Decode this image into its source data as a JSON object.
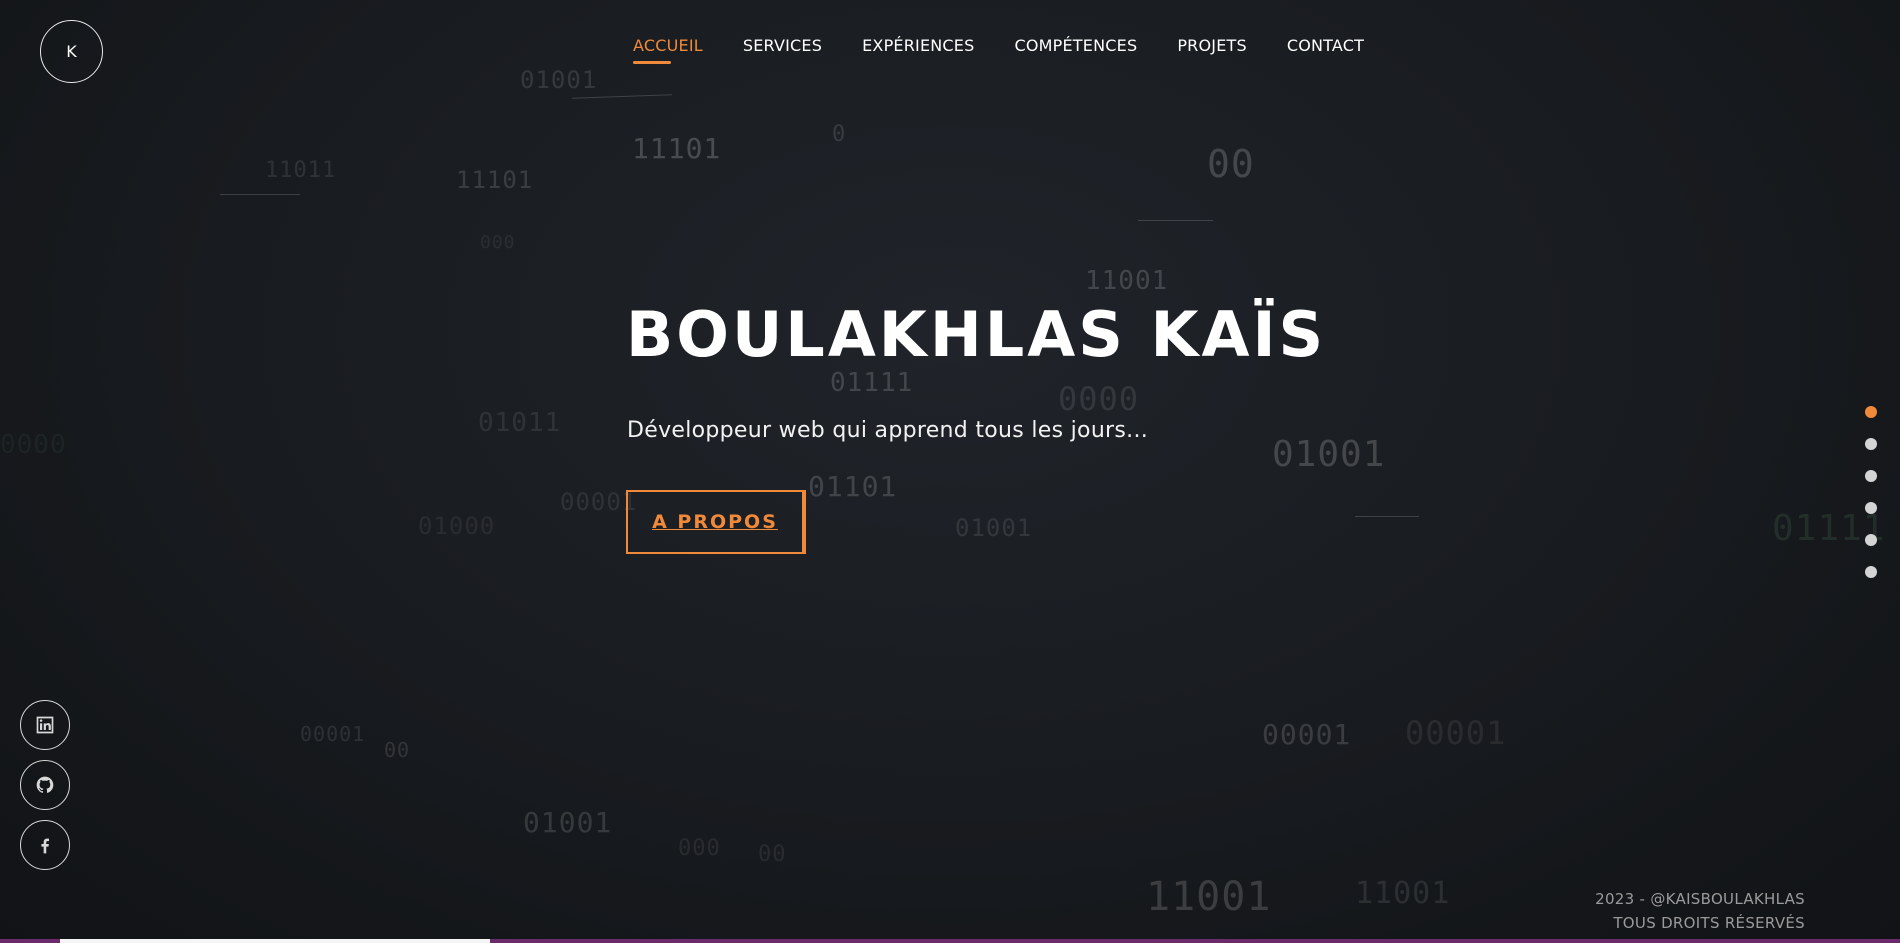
{
  "logo": {
    "letter": "K"
  },
  "nav": {
    "items": [
      "ACCUEIL",
      "SERVICES",
      "EXPÉRIENCES",
      "COMPÉTENCES",
      "PROJETS",
      "CONTACT"
    ],
    "active": "ACCUEIL"
  },
  "hero": {
    "title": "BOULAKHLAS KAÏS",
    "subtitle": "Développeur web qui apprend tous les jours...",
    "button_label": "A PROPOS"
  },
  "section_dots": {
    "count": 6,
    "active_index": 0
  },
  "socials": [
    "linkedin-icon",
    "github-icon",
    "facebook-icon"
  ],
  "footer": {
    "line1": "2023 - @KAISBOULAKHLAS",
    "line2": "TOUS DROITS RÉSERVÉS"
  },
  "background_digits": [
    "01001",
    "11101",
    "0",
    "00",
    "11011",
    "11101",
    "000",
    "01111",
    "11001",
    "01011",
    "0000",
    "01001",
    "01101",
    "00001",
    "01001",
    "01000",
    "00001",
    "00",
    "01001",
    "000",
    "00",
    "11001",
    "11001",
    "00001",
    "00001",
    "01111",
    "0000"
  ],
  "colors": {
    "accent": "#f08a3a",
    "background": "#16181b",
    "text": "#ffffff",
    "footer_text": "#9a9a9a"
  },
  "scroll_progress": 0.23
}
